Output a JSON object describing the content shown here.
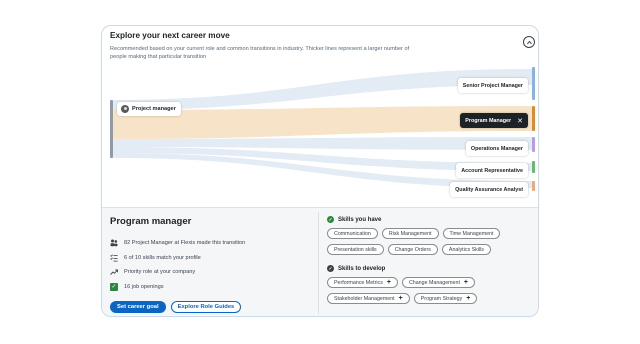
{
  "header": {
    "title": "Explore your next career move",
    "subtitle": "Recommended based on your current role and common transitions in industry. Thicker lines represent a larger number of people making that particular transition"
  },
  "flow": {
    "source": {
      "label": "Project manager",
      "color": "#8f9bab"
    },
    "targets": [
      {
        "label": "Senior Project Manager",
        "color": "#7fb5e8",
        "active": false
      },
      {
        "label": "Program Manager",
        "color": "#e58a1f",
        "active": true
      },
      {
        "label": "Operations Manager",
        "color": "#b79be6",
        "active": false
      },
      {
        "label": "Account Representative",
        "color": "#5fbf6a",
        "active": false
      },
      {
        "label": "Quality Assurance Analyst",
        "color": "#f0a877",
        "active": false
      }
    ],
    "close_symbol": "✕"
  },
  "detail": {
    "role_title": "Program manager",
    "info": [
      {
        "icon": "people-icon",
        "text": "82 Project Manager at Flexis made this transition"
      },
      {
        "icon": "checklist-icon",
        "text": "6 of 10 skills match your profile"
      },
      {
        "icon": "trending-up-icon",
        "text": "Priority role at your company"
      },
      {
        "icon": "job-check-icon",
        "text": "16 job openings"
      }
    ],
    "primary_button": "Set career goal",
    "secondary_button": "Explore Role Guides"
  },
  "skills_have": {
    "heading": "Skills you have",
    "items": [
      "Communication",
      "Risk Management",
      "Time Management",
      "Presentation skills",
      "Change Orders",
      "Analytics Skills"
    ]
  },
  "skills_develop": {
    "heading": "Skills to develop",
    "items": [
      "Performance Metrics",
      "Change Management",
      "Stakeholder Management",
      "Program Strategy"
    ],
    "add_symbol": "+"
  },
  "colors": {
    "accent": "#0a66c2",
    "success": "#2e8540"
  }
}
